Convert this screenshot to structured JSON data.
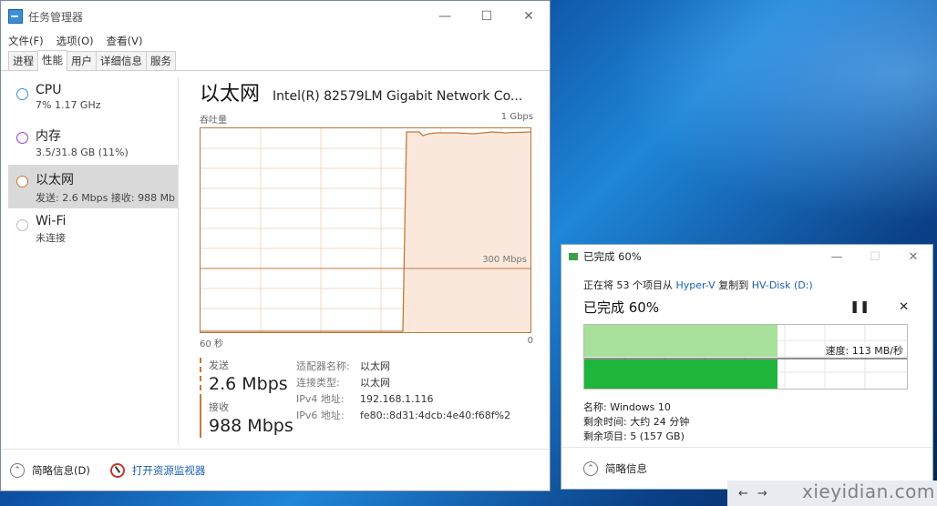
{
  "task_manager": {
    "title": "任务管理器",
    "menu": [
      "文件(F)",
      "选项(O)",
      "查看(V)"
    ],
    "tabs": [
      "进程",
      "性能",
      "用户",
      "详细信息",
      "服务"
    ],
    "active_tab_index": 1,
    "resources": [
      {
        "name": "CPU",
        "sub": "7% 1.17 GHz",
        "color": "#3d8fd6"
      },
      {
        "name": "内存",
        "sub": "3.5/31.8 GB (11%)",
        "color": "#a040c0"
      },
      {
        "name": "以太网",
        "sub": "发送: 2.6 Mbps 接收: 988 Mb",
        "color": "#c8783a"
      },
      {
        "name": "Wi-Fi",
        "sub": "未连接",
        "color": "#bbbbbb"
      }
    ],
    "selected_resource_index": 2,
    "detail": {
      "title": "以太网",
      "adapter": "Intel(R) 82579LM Gigabit Network Co...",
      "graph_label": "吞吐量",
      "graph_max": "1 Gbps",
      "graph_mid": "300 Mbps",
      "x_left": "60 秒",
      "x_right": "0",
      "send_label": "发送",
      "send_value": "2.6 Mbps",
      "recv_label": "接收",
      "recv_value": "988 Mbps",
      "properties": [
        {
          "k": "适配器名称:",
          "v": "以太网"
        },
        {
          "k": "连接类型:",
          "v": "以太网"
        },
        {
          "k": "IPv4 地址:",
          "v": "192.168.1.116"
        },
        {
          "k": "IPv6 地址:",
          "v": "fe80::8d31:4dcb:4e40:f68f%2"
        }
      ],
      "series_color": "#c8783a",
      "fill_color": "#fbe8dc"
    },
    "footer": {
      "summary": "简略信息(D)",
      "monitor": "打开资源监视器"
    }
  },
  "copy_dialog": {
    "title": "已完成 60%",
    "line_prefix": "正在将 53 个项目从 ",
    "source": "Hyper-V",
    "line_mid": " 复制到 ",
    "dest": "HV-Disk (D:)",
    "status": "已完成 60%",
    "progress": 0.6,
    "speed": "速度: 113 MB/秒",
    "name_label": "名称:",
    "name_value": "Windows 10",
    "remaining_time_label": "剩余时间:",
    "remaining_time_value": "大约 24 分钟",
    "remaining_items_label": "剩余项目:",
    "remaining_items_value": "5 (157 GB)",
    "footer": "简略信息"
  },
  "watermark": "xieyidian.com"
}
